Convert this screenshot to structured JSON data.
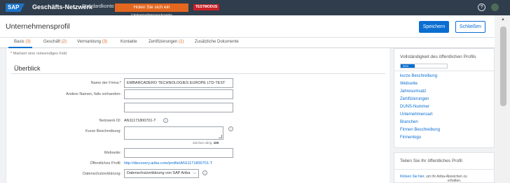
{
  "topbar": {
    "logo": "SAP",
    "network_title": "Geschäfts-Netzwerk",
    "network_caret": "⌄",
    "standard_account": "Standardkonto",
    "enterprise_button": "Holen Sie sich ein Unternehmenskonto",
    "test_badge": "TESTMODUS",
    "help_icon": "?"
  },
  "header": {
    "title": "Unternehmensprofil",
    "save_label": "Speichern",
    "close_label": "Schließen"
  },
  "tabs": [
    {
      "label": "Basis",
      "count": "(3)"
    },
    {
      "label": "Geschäft",
      "count": "(2)"
    },
    {
      "label": "Vermarktung",
      "count": "(3)"
    },
    {
      "label": "Kontakte",
      "count": ""
    },
    {
      "label": "Zertifizierungen",
      "count": "(1)"
    },
    {
      "label": "Zusätzliche Dokumente",
      "count": ""
    }
  ],
  "form": {
    "required_note": "* Markiert eine notwendiges Feld",
    "section_title": "Überblick",
    "company_name_label": "Name der Firma:*",
    "company_name_value": "EMBARCADERO TECHNOLOGIES EUROPE LTD-TEST",
    "other_names_label": "Andere Namen, falls vorhanden:",
    "other_names_value_1": "",
    "other_names_value_2": "",
    "network_id_label": "Netzwerk ID:",
    "network_id_value": "AN11171800701-T",
    "short_desc_label": "Kurze Beschreibung:",
    "char_count_label": "Zeichen übrig:",
    "char_count_value": "100",
    "website_label": "Webseite:",
    "website_value": "",
    "public_profile_label": "Öffentliches Profil:",
    "public_profile_link": "http://discovery.ariba.com/profile/AN11171800701-T",
    "privacy_label": "Datenschutzerklärung:",
    "privacy_value": "Datenschutzerklärung von SAP Ariba",
    "info_glyph": "i"
  },
  "sidebar": {
    "completeness_title": "Vollständigkeit des öffentlichen Profils",
    "progress_label": "30%",
    "progress_value": 0.3,
    "links": [
      "kurze Beschreibung",
      "Webseite",
      "Jahresumsatz",
      "Zertifizierungen",
      "DUNS-Nummer",
      "Unternehmensart",
      "Branchen",
      "Firmen Beschreibung",
      "Firmenlogo"
    ],
    "share_title": "Teilen Sie Ihr öffentliches Profil",
    "share_link": "Klicken Sie hier",
    "share_text": ", um Ihr Ariba-Abzeichen zu",
    "share_text2": "erhalten."
  },
  "scrollbar": {
    "up_arrow": "▲"
  },
  "colors": {
    "brand": "#0a6ed1",
    "topbar": "#2f3d4c",
    "accent_orange": "#e3671f",
    "badge_red": "#c82027"
  }
}
